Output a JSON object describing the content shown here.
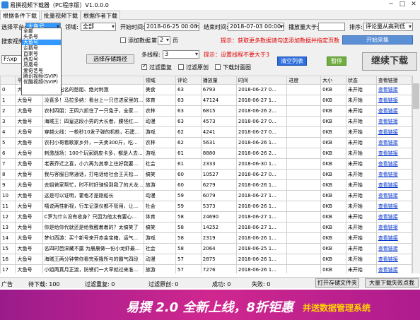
{
  "window": {
    "title": "易撰视频下载器（PC程序版）V1.0.0.0"
  },
  "tabs": [
    {
      "label": "根据条件下载"
    },
    {
      "label": "批量视频下载"
    },
    {
      "label": "根据作者下载"
    }
  ],
  "filters": {
    "platform_label": "选择平台:",
    "platform_value": "大鱼号",
    "field_label": "领域:",
    "field_value": "全部",
    "start_label": "开始时间:",
    "start_value": "2018-06-25 00:00:00",
    "end_label": "结束时间:",
    "end_value": "2018-07-03 00:00:00",
    "play_label": "播放量大于:",
    "play_value": "",
    "sort_label": "排序:",
    "sort_value": "评论量从高到低",
    "add_data_label": "添加数据",
    "page_prefix": "第",
    "page_value": "2",
    "page_suffix": "页",
    "hint1": "提示：获取更多数据请勾选添加数据并指定页数",
    "start_collect_btn": "开始采集",
    "search_label": "搜索视频:",
    "path_value": "F:\\xp",
    "path_btn": "选择存储路径",
    "threads_label": "多线程:",
    "threads_value": "3",
    "hint2": "提示：设置线程不要大于3",
    "clear_btn": "清空列表",
    "pause_btn": "暂停",
    "continue_btn": "继续下载",
    "filter_dup_label": "过滤重复",
    "filter_orig_label": "过滤原创",
    "download_cover_label": "下载封面图"
  },
  "dropdown": {
    "items": [
      "全部",
      "头条号",
      "大鱼号",
      "企鹅号",
      "百家号",
      "西瓜号",
      "凤凰号",
      "爱奇艺号",
      "腾讯视频(SVIP)",
      "优酷视频(SVIP)"
    ],
    "highlighted": 2
  },
  "table": {
    "columns": [
      "",
      "平台",
      "标题",
      "领域",
      "评论",
      "播放量",
      "时间",
      "进度",
      "大小",
      "状态",
      "查看链接"
    ],
    "rows": [
      [
        "0",
        "大鱼号",
        "宣判最出名的憋屈、绝对刺激",
        "美食",
        "63",
        "6793",
        "2018-06-27 0...",
        "",
        "0KB",
        "未开始",
        "查看链接"
      ],
      [
        "1",
        "大鱼号",
        "没喜多！马拉多纳：看台上一只住进家里的...",
        "体育",
        "63",
        "47124",
        "2018-06-27 1...",
        "",
        "0KB",
        "未开始",
        "查看链接"
      ],
      [
        "2",
        "大鱼号",
        "农村四朋：王四六抓住了一只兔子，全家...",
        "农林",
        "63",
        "6815",
        "2018-06-26 2...",
        "",
        "0KB",
        "未开始",
        "查看链接"
      ],
      [
        "3",
        "大鱼号",
        "海贼王：四皇这段小男的大长者，腰怪红...",
        "动漫",
        "63",
        "4573",
        "2018-06-27 0...",
        "",
        "0KB",
        "未开始",
        "查看链接"
      ],
      [
        "4",
        "大鱼号",
        "穿越火线：一枪秒10发子弹的机枪，石建...",
        "游戏",
        "62",
        "4241",
        "2018-06-27 0...",
        "",
        "0KB",
        "未开始",
        "查看链接"
      ],
      [
        "5",
        "大鱼号",
        "农村小哥看歌家乡外，一天卖300斤，吃...",
        "农林",
        "62",
        "5631",
        "2018-06-26 1...",
        "",
        "0KB",
        "未开始",
        "查看链接"
      ],
      [
        "6",
        "大鱼号",
        "刺激战场：100个玩家跳皮卡多，都是人去...",
        "游戏",
        "61",
        "8880",
        "2018-06-26 2...",
        "",
        "0KB",
        "未开始",
        "查看链接"
      ],
      [
        "7",
        "大鱼号",
        "老表乔迁之喜，小六再为其拳上往好我要...",
        "社会",
        "61",
        "2333",
        "2018-06-30 1...",
        "",
        "0KB",
        "未开始",
        "查看链接"
      ],
      [
        "8",
        "大鱼号",
        "我与客服日常通话，打电话给社会王天松...",
        "搞笑",
        "60",
        "10527",
        "2018-06-27 0...",
        "",
        "0KB",
        "未开始",
        "查看链接"
      ],
      [
        "9",
        "大鱼号",
        "去姐爸家帮忙，时不时好骑轻到我了的大龙...",
        "旅游",
        "60",
        "6279",
        "2018-06-26 1...",
        "",
        "0KB",
        "未开始",
        "查看链接"
      ],
      [
        "10",
        "大鱼号",
        "这是可以证明，霍格才是刚船长",
        "动漫",
        "59",
        "6079",
        "2018-06-27 1...",
        "",
        "0KB",
        "未开始",
        "查看链接"
      ],
      [
        "11",
        "大鱼号",
        "嘻说两性新视，行车记录仪都不管用，让...",
        "社会",
        "59",
        "5373",
        "2018-06-26 1...",
        "",
        "0KB",
        "未开始",
        "查看链接"
      ],
      [
        "12",
        "大鱼号",
        "C罗为什么没有收身？只因为他太有要心...",
        "体育",
        "58",
        "24690",
        "2018-06-27 1...",
        "",
        "0KB",
        "未开始",
        "查看链接"
      ],
      [
        "13",
        "大鱼号",
        "你是给你代就还是给我醒着着的？太搞笑了",
        "搞笑",
        "58",
        "14252",
        "2018-06-27 1...",
        "",
        "0KB",
        "未开始",
        "查看链接"
      ],
      [
        "14",
        "大鱼号",
        "梦幻西游：买个新号来开赤金宝箱，运气...",
        "游戏",
        "58",
        "2319",
        "2018-06-26 1...",
        "",
        "0KB",
        "未开始",
        "查看链接"
      ],
      [
        "15",
        "大鱼号",
        "名四时芭深藏不露 为晨晨做一份小龙虾最...",
        "社会",
        "58",
        "2064",
        "2018-06-25 1...",
        "",
        "0KB",
        "未开始",
        "查看链接"
      ],
      [
        "16",
        "大鱼号",
        "海贼王两分钟带你看完索隆所与的霸气四段",
        "动漫",
        "57",
        "2875",
        "2018-06-26 1...",
        "",
        "0KB",
        "未开始",
        "查看链接"
      ],
      [
        "17",
        "大鱼号",
        "小姐两真月正渡，防锈们一大早就过来准...",
        "旅游",
        "57",
        "7276",
        "2018-06-26 1...",
        "",
        "0KB",
        "未开始",
        "查看链接"
      ]
    ]
  },
  "status": {
    "ad_label": "广告",
    "pending": "待下载: 100",
    "filtered_dup": "过滤重复: 0",
    "filtered_orig": "过滤原创: 0",
    "success": "成功: 0",
    "failed": "失败: 0",
    "open_folder_btn": "打开存储文件夹",
    "batch_btn": "大量下载失败点我"
  },
  "banner": {
    "text1": "易撰 2.0 全新上线，8折钜惠",
    "text2": "并送数据管理系统"
  },
  "colors": {
    "accent": "#3399ff",
    "hint": "#e00000",
    "banner": "#c42590",
    "banner_highlight": "#ffd400"
  }
}
